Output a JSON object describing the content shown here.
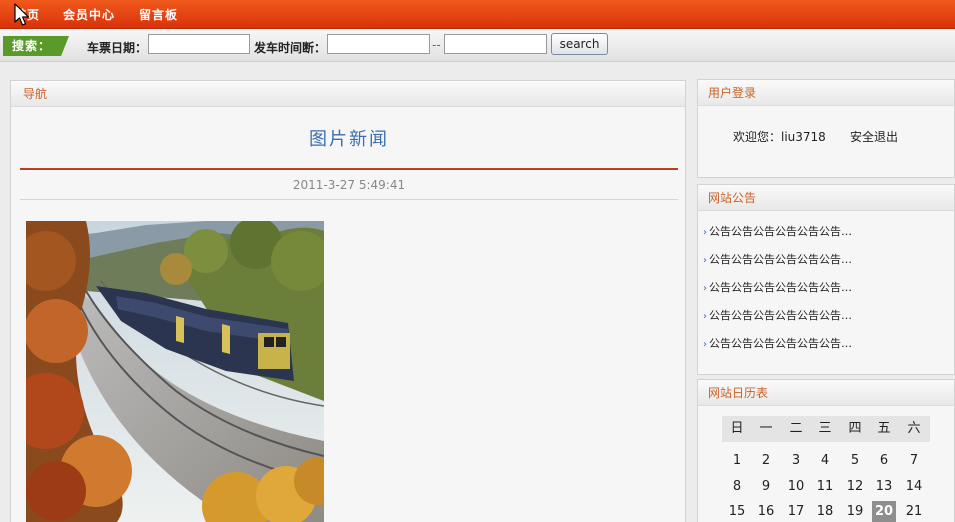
{
  "nav": {
    "items": [
      "首页",
      "会员中心",
      "留言板"
    ]
  },
  "search": {
    "tag": "搜索：",
    "date_label": "车票日期：",
    "time_label": "发车时间断：",
    "date_value": "",
    "time_from_value": "",
    "time_to_value": "",
    "separator": "--",
    "button_label": "search"
  },
  "main": {
    "nav_title": "导航",
    "news_title": "图片新闻",
    "news_date": "2011-3-27 5:49:41"
  },
  "login": {
    "title": "用户登录",
    "welcome": "欢迎您：liu3718",
    "logout": "安全退出"
  },
  "notice": {
    "title": "网站公告",
    "items": [
      "公告公告公告公告公告公告…",
      "公告公告公告公告公告公告…",
      "公告公告公告公告公告公告…",
      "公告公告公告公告公告公告…",
      "公告公告公告公告公告公告…"
    ]
  },
  "calendar": {
    "title": "网站日历表",
    "weekdays": [
      "日",
      "一",
      "二",
      "三",
      "四",
      "五",
      "六"
    ],
    "weeks": [
      [
        "1",
        "2",
        "3",
        "4",
        "5",
        "6",
        "7"
      ],
      [
        "8",
        "9",
        "10",
        "11",
        "12",
        "13",
        "14"
      ],
      [
        "15",
        "16",
        "17",
        "18",
        "19",
        "20",
        "21"
      ]
    ],
    "today": "20"
  },
  "colors": {
    "brand": "#e2400f",
    "accent_green": "#5a9a2a",
    "heading_orange": "#c8622a",
    "title_blue": "#3a6fae"
  }
}
